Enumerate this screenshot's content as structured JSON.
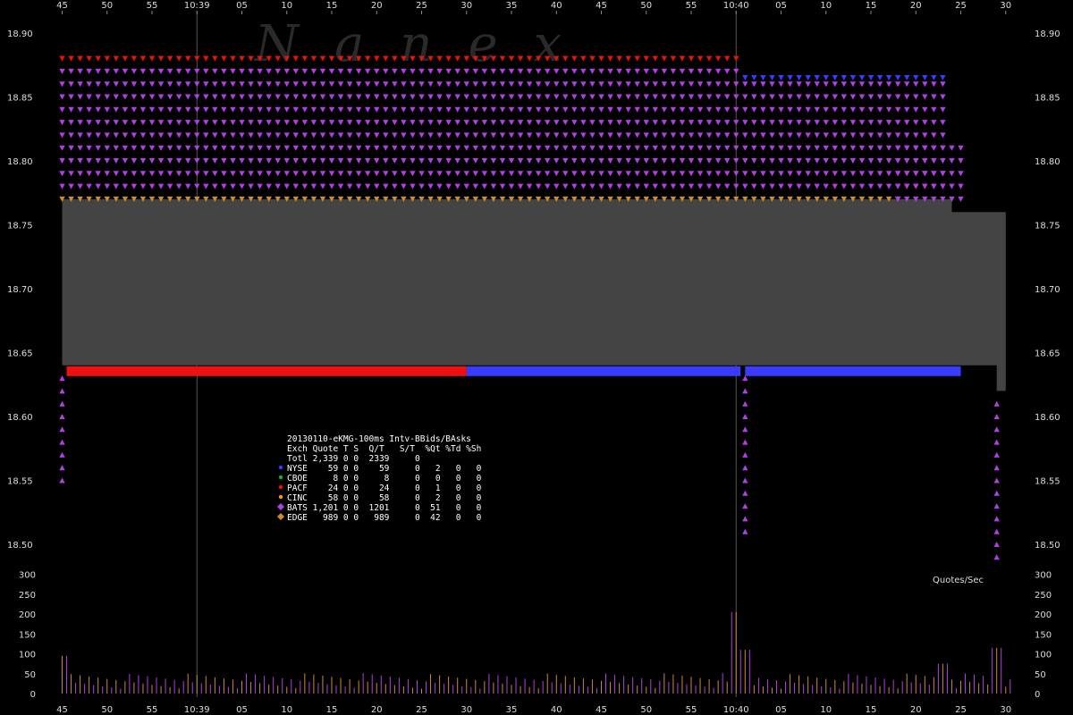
{
  "chart_data": {
    "type": "scatter",
    "title": "20130110-eKMG-100ms Intv-BBids/BAsks",
    "watermark": "Nanex",
    "time_axis": {
      "labels": [
        "45",
        "50",
        "55",
        "10:39",
        "05",
        "10",
        "15",
        "20",
        "25",
        "30",
        "35",
        "40",
        "45",
        "50",
        "55",
        "10:40",
        "05",
        "10",
        "15",
        "20",
        "25",
        "30"
      ],
      "start": "10:38:45",
      "end": "10:40:30",
      "label_interval_seconds": 5,
      "major_labels": [
        "10:39",
        "10:40"
      ]
    },
    "price_axis": {
      "ticks": [
        "18.90",
        "18.85",
        "18.80",
        "18.75",
        "18.70",
        "18.65",
        "18.60",
        "18.55",
        "18.50"
      ],
      "ylim": [
        18.48,
        18.92
      ]
    },
    "rate_axis": {
      "label": "Quotes/Sec",
      "ticks": [
        "300",
        "250",
        "200",
        "150",
        "100",
        "50",
        "0"
      ],
      "ylim": [
        0,
        300
      ]
    },
    "colors": {
      "NYSE": "#3b3bff",
      "CBOE": "#22aa22",
      "PACF": "#ee1111",
      "CINC": "#f0a000",
      "BATS": "#b040e0",
      "EDGE": "#d08a30",
      "spread": "#444444",
      "red_bar": "#ff0000",
      "blue_bar": "#3333ee"
    },
    "nbbo": {
      "best_ask": [
        {
          "t": "10:38:45",
          "v": 18.77
        },
        {
          "t": "10:40:24",
          "v": 18.76
        },
        {
          "t": "10:40:30",
          "v": 18.75
        }
      ],
      "best_bid": [
        {
          "t": "10:38:45",
          "v": 18.64
        },
        {
          "t": "10:40:29",
          "v": 18.62
        },
        {
          "t": "10:40:30",
          "v": 18.62
        }
      ]
    },
    "bid_bar_segments": [
      {
        "start": "10:38:45.5",
        "end": "10:39:30",
        "exchange": "PACF",
        "price": 18.64
      },
      {
        "start": "10:39:30",
        "end": "10:40:00.5",
        "exchange": "NYSE",
        "price": 18.64
      },
      {
        "start": "10:40:01",
        "end": "10:40:25",
        "exchange": "NYSE",
        "price": 18.64
      }
    ],
    "ask_levels": [
      {
        "exchange": "PACF",
        "start": "10:38:45",
        "end": "10:40:00",
        "price": 18.88
      },
      {
        "exchange": "BATS",
        "start": "10:38:45",
        "end": "10:40:00",
        "prices": [
          18.87,
          18.86,
          18.85,
          18.84,
          18.83,
          18.82,
          18.81,
          18.8,
          18.79,
          18.78
        ]
      },
      {
        "exchange": "EDGE",
        "start": "10:38:45",
        "end": "10:40:00",
        "price": 18.77
      },
      {
        "exchange": "NYSE",
        "start": "10:40:01",
        "end": "10:40:23",
        "price": 18.865
      },
      {
        "exchange": "BATS",
        "start": "10:40:01",
        "end": "10:40:23",
        "prices": [
          18.86,
          18.85,
          18.84,
          18.83,
          18.82,
          18.81,
          18.8,
          18.79,
          18.78
        ]
      },
      {
        "exchange": "EDGE",
        "start": "10:40:01",
        "end": "10:40:18",
        "price": 18.77
      },
      {
        "exchange": "BATS",
        "start": "10:40:18",
        "end": "10:40:25",
        "prices": [
          18.81,
          18.8,
          18.79,
          18.78,
          18.77
        ]
      }
    ],
    "legend": {
      "header": "Exch Quote T S  Q/T   S/T  %Qt %Td %Sh",
      "total": "Totl 2,339 0 0  2339     0",
      "rows": [
        {
          "exch": "NYSE",
          "text": "NYSE    59 0 0    59     0   2   0   0",
          "marker": "dot"
        },
        {
          "exch": "CBOE",
          "text": "CBOE     8 0 0     8     0   0   0   0",
          "marker": "dot"
        },
        {
          "exch": "PACF",
          "text": "PACF    24 0 0    24     0   1   0   0",
          "marker": "dot"
        },
        {
          "exch": "CINC",
          "text": "CINC    58 0 0    58     0   2   0   0",
          "marker": "dot"
        },
        {
          "exch": "BATS",
          "text": "BATS 1,201 0 0  1201     0  51   0   0",
          "marker": "diamond"
        },
        {
          "exch": "EDGE",
          "text": "EDGE   989 0 0   989     0  42   0   0",
          "marker": "diamond"
        }
      ]
    },
    "quote_rate_peaks": [
      {
        "t": "10:38:45",
        "v": 95
      },
      {
        "t": "10:40:00",
        "v": 205
      },
      {
        "t": "10:40:01",
        "v": 110
      },
      {
        "t": "10:40:23",
        "v": 75
      },
      {
        "t": "10:40:29",
        "v": 115
      }
    ]
  }
}
